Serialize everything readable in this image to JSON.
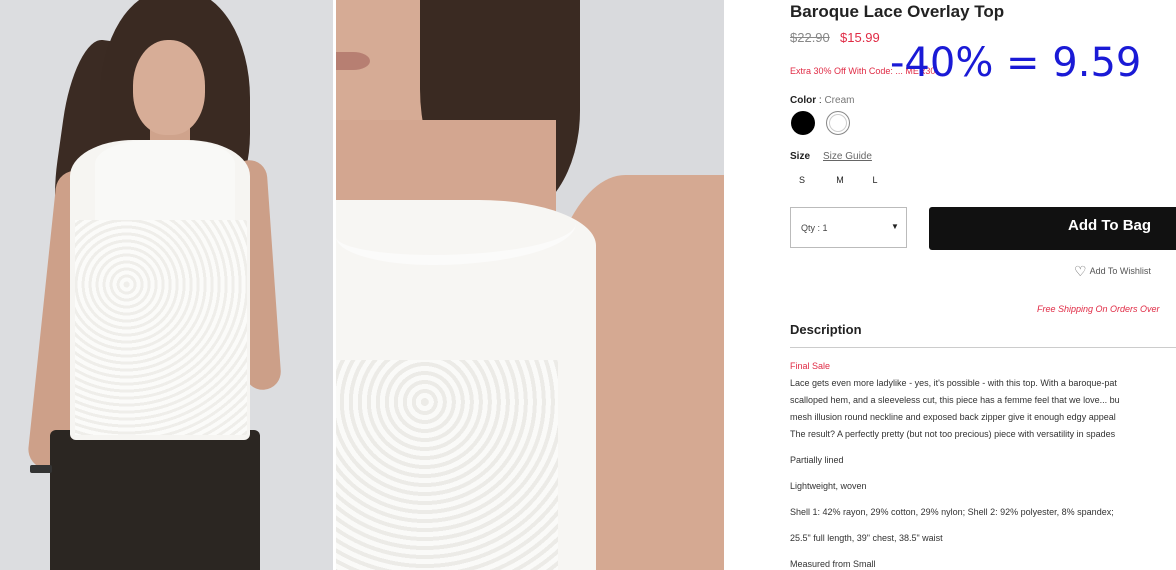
{
  "product": {
    "title": "Baroque Lace Overlay Top",
    "price_original": "$22.90",
    "price_sale": "$15.99",
    "promo_text": "Extra 30% Off With Code: ... MER30",
    "annotation": "-40% = 9.59"
  },
  "color": {
    "label": "Color",
    "separator": " : ",
    "selected": "Cream",
    "swatches": [
      "black",
      "cream"
    ]
  },
  "size": {
    "label": "Size",
    "guide_link": "Size Guide",
    "options": [
      "S",
      "M",
      "L"
    ]
  },
  "cart": {
    "qty_label": "Qty : 1",
    "add_to_bag": "Add To Bag",
    "wishlist": "Add To Wishlist"
  },
  "shipping_banner": "Free Shipping On Orders Over",
  "description": {
    "heading": "Description",
    "final_sale": "Final Sale",
    "lines": [
      "Lace gets even more ladylike - yes, it's possible - with this top. With a baroque-pat",
      "scalloped hem, and a sleeveless cut, this piece has a femme feel that we love... bu",
      "mesh illusion round neckline and exposed back zipper give it enough edgy appeal",
      "The result? A perfectly pretty (but not too precious) piece with versatility in spades"
    ],
    "details": [
      "Partially lined",
      "Lightweight, woven",
      "Shell 1: 42% rayon, 29% cotton, 29% nylon; Shell 2: 92% polyester, 8% spandex;",
      "25.5\" full length, 39\" chest, 38.5\" waist",
      "Measured from Small"
    ]
  },
  "colors": {
    "sale_red": "#e02b45",
    "button_black": "#111111",
    "annotation_blue": "#1a1ad6"
  }
}
